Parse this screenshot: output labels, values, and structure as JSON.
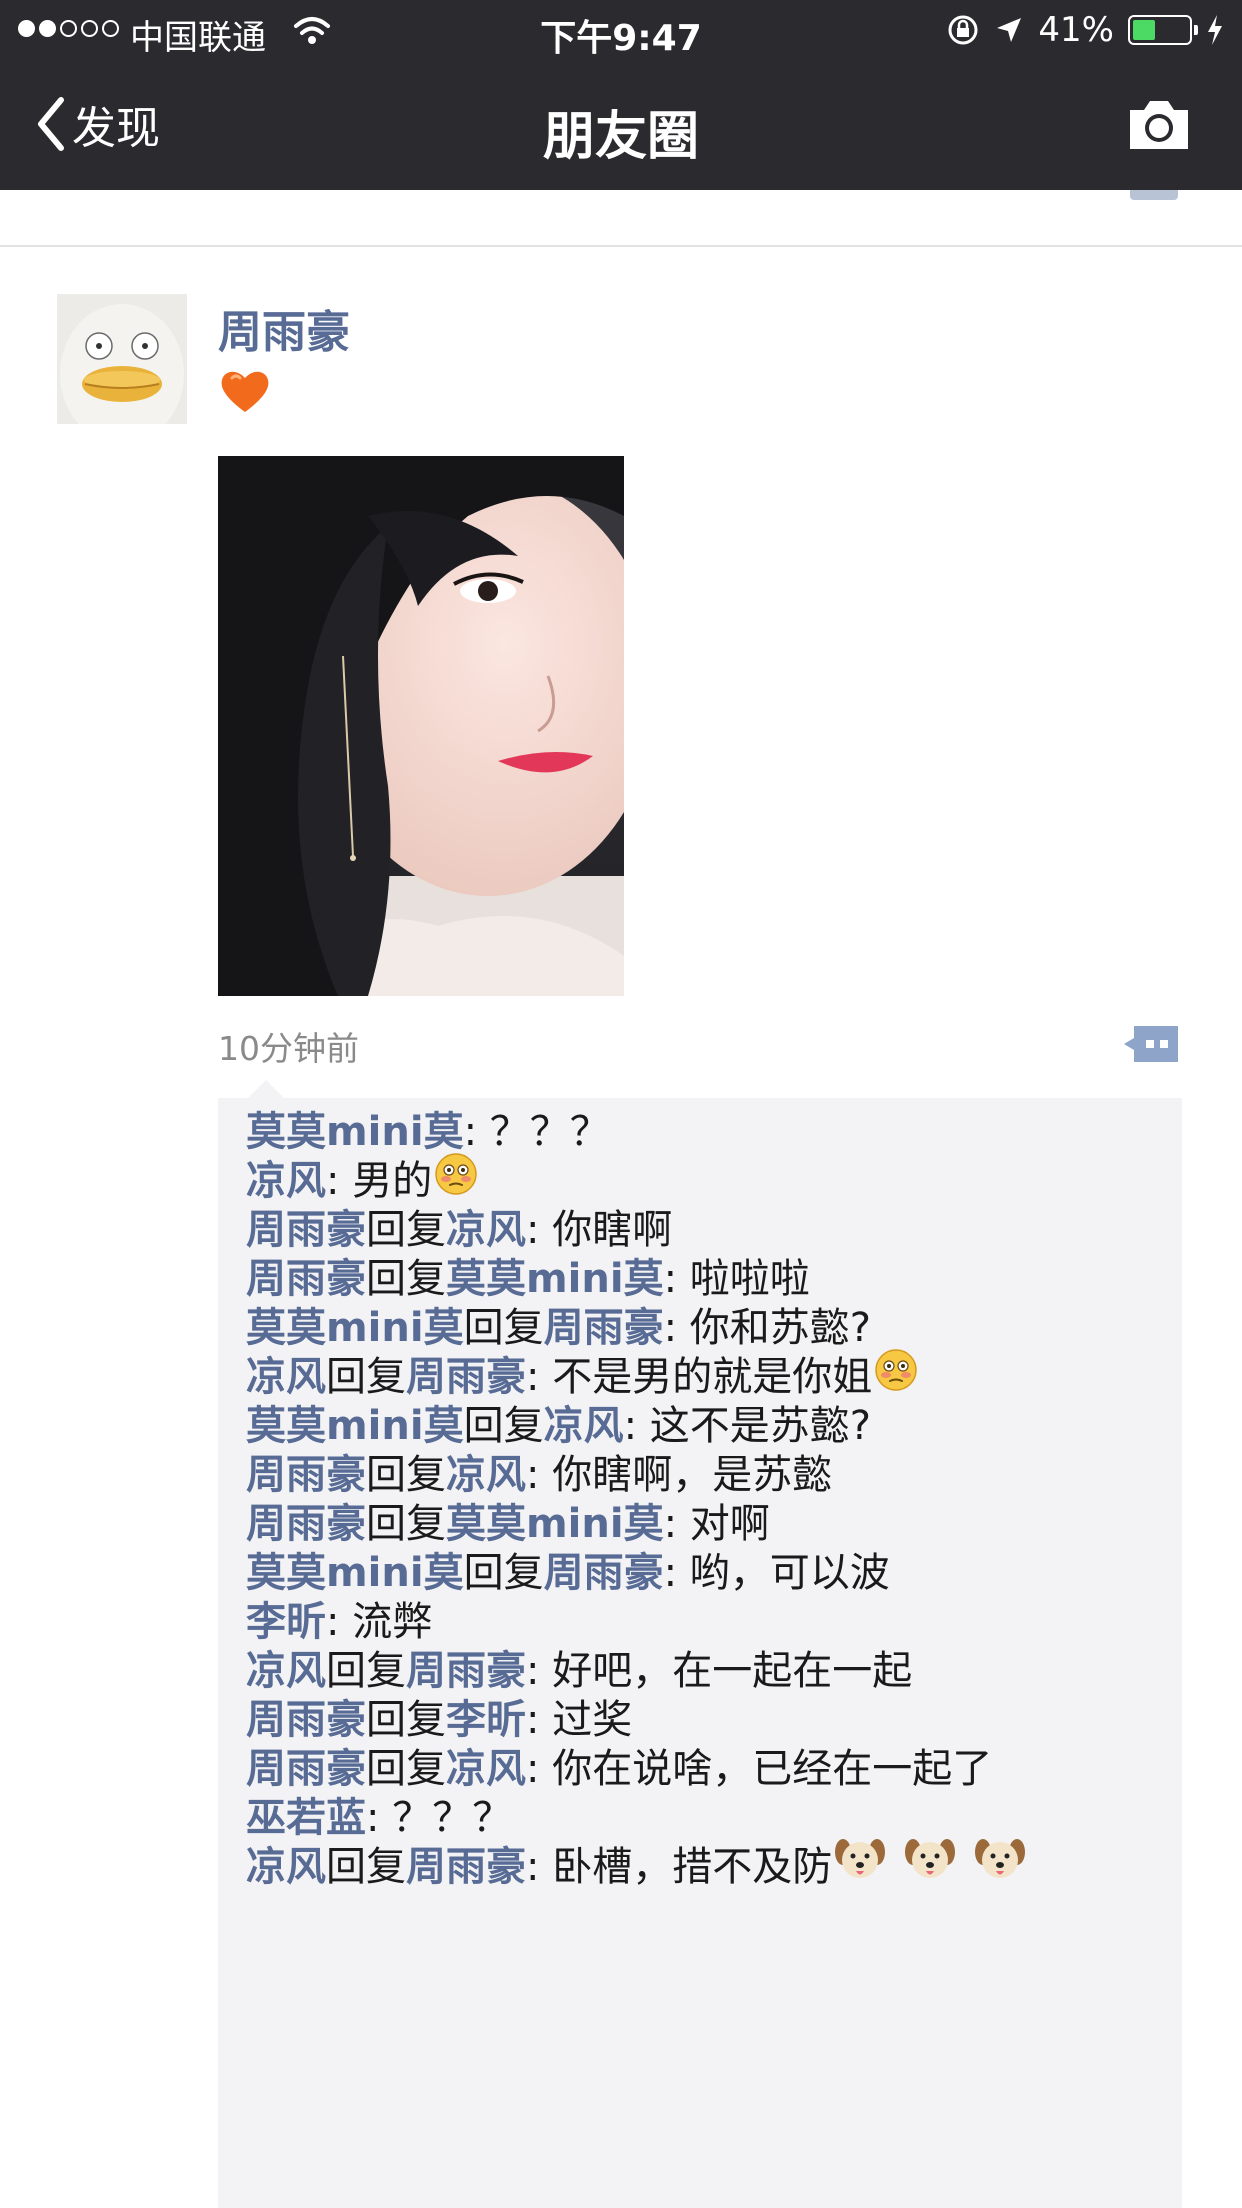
{
  "status_bar": {
    "carrier": "中国联通",
    "time": "下午9:47",
    "battery_percent": "41%",
    "battery_level": 0.41,
    "signal_bars_filled": 2,
    "signal_bars_total": 5
  },
  "nav": {
    "back_label": "发现",
    "title": "朋友圈"
  },
  "colors": {
    "nav_background": "#2b2b2f",
    "link_blue": "#576b95",
    "comment_background": "#f3f3f5",
    "battery_green": "#4cd964"
  },
  "post": {
    "author": "周雨豪",
    "time_ago": "10分钟前",
    "content_icon": "orange-heart-emoji"
  },
  "comments": [
    {
      "from": "莫莫mini莫",
      "reply": "",
      "to": "",
      "colon": ": ",
      "text": "？？？",
      "emoji": ""
    },
    {
      "from": "凉风",
      "reply": "",
      "to": "",
      "colon": ": ",
      "text": "男的",
      "emoji": "flushed-face"
    },
    {
      "from": "周雨豪",
      "reply": "回复",
      "to": "凉风",
      "colon": ": ",
      "text": "你瞎啊",
      "emoji": ""
    },
    {
      "from": "周雨豪",
      "reply": "回复",
      "to": "莫莫mini莫",
      "colon": ": ",
      "text": "啦啦啦",
      "emoji": ""
    },
    {
      "from": "莫莫mini莫",
      "reply": "回复",
      "to": "周雨豪",
      "colon": ": ",
      "text": "你和苏懿?",
      "emoji": ""
    },
    {
      "from": "凉风",
      "reply": "回复",
      "to": "周雨豪",
      "colon": ": ",
      "text": "不是男的就是你姐",
      "emoji": "flushed-face"
    },
    {
      "from": "莫莫mini莫",
      "reply": "回复",
      "to": "凉风",
      "colon": ": ",
      "text": "这不是苏懿?",
      "emoji": ""
    },
    {
      "from": "周雨豪",
      "reply": "回复",
      "to": "凉风",
      "colon": ": ",
      "text": "你瞎啊，是苏懿",
      "emoji": ""
    },
    {
      "from": "周雨豪",
      "reply": "回复",
      "to": "莫莫mini莫",
      "colon": ": ",
      "text": "对啊",
      "emoji": ""
    },
    {
      "from": "莫莫mini莫",
      "reply": "回复",
      "to": "周雨豪",
      "colon": ": ",
      "text": "哟，可以波",
      "emoji": ""
    },
    {
      "from": "李昕",
      "reply": "",
      "to": "",
      "colon": ": ",
      "text": "流弊",
      "emoji": ""
    },
    {
      "from": "凉风",
      "reply": "回复",
      "to": "周雨豪",
      "colon": ": ",
      "text": "好吧，在一起在一起",
      "emoji": ""
    },
    {
      "from": "周雨豪",
      "reply": "回复",
      "to": "李昕",
      "colon": ": ",
      "text": "过奖",
      "emoji": ""
    },
    {
      "from": "周雨豪",
      "reply": "回复",
      "to": "凉风",
      "colon": ": ",
      "text": "你在说啥，已经在一起了",
      "emoji": ""
    },
    {
      "from": "巫若蓝",
      "reply": "",
      "to": "",
      "colon": ": ",
      "text": "？？？",
      "emoji": ""
    },
    {
      "from": "凉风",
      "reply": "回复",
      "to": "周雨豪",
      "colon": ": ",
      "text": "卧槽，措不及防",
      "emoji": "dog-face-x3"
    }
  ]
}
